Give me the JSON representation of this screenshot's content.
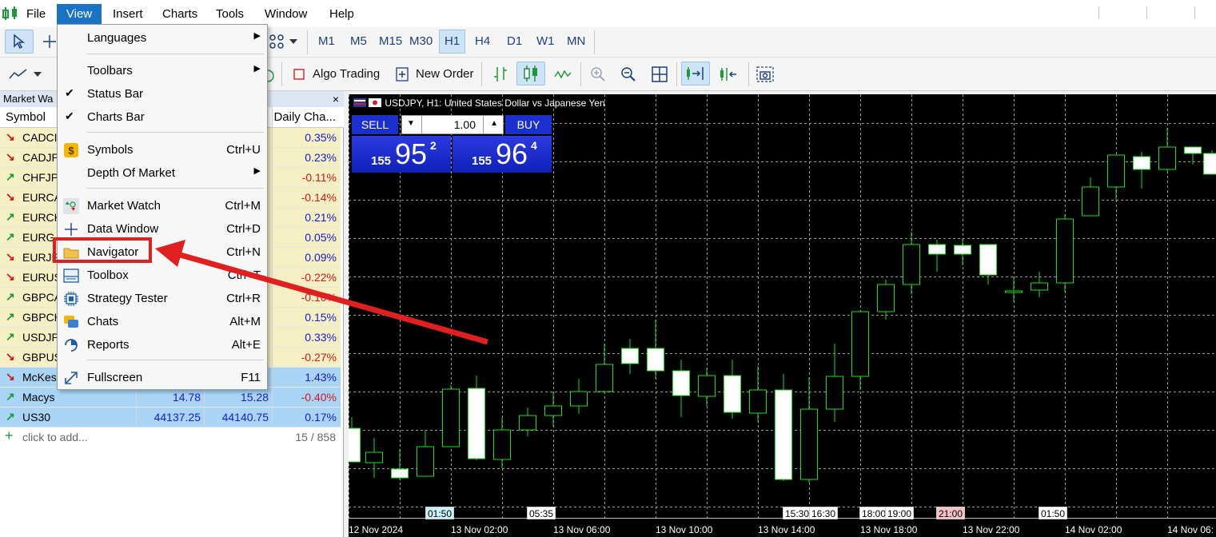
{
  "menubar": {
    "items": [
      "File",
      "View",
      "Insert",
      "Charts",
      "Tools",
      "Window",
      "Help"
    ],
    "active": "View"
  },
  "toolbar1": {
    "timeframes": [
      "M1",
      "M5",
      "M15",
      "M30",
      "H1",
      "H4",
      "D1",
      "W1",
      "MN"
    ],
    "selected_timeframe": "H1"
  },
  "toolbar2": {
    "algo_trading_label": "Algo Trading",
    "new_order_label": "New Order"
  },
  "market_watch": {
    "title": "Market Wa",
    "close_glyph": "×",
    "columns": {
      "symbol": "Symbol",
      "change": "Daily Cha..."
    },
    "rows": [
      {
        "symbol": "CADCI",
        "bid": "",
        "ask": "",
        "change": "0.35%",
        "dir": "down",
        "change_color": "#1a1ad0"
      },
      {
        "symbol": "CADJP",
        "bid": "",
        "ask": "",
        "change": "0.23%",
        "dir": "down",
        "change_color": "#1a1ad0"
      },
      {
        "symbol": "CHFJP",
        "bid": "",
        "ask": "",
        "change": "-0.11%",
        "dir": "up",
        "change_color": "#d01a1a"
      },
      {
        "symbol": "EURCA",
        "bid": "",
        "ask": "",
        "change": "-0.14%",
        "dir": "down",
        "change_color": "#d01a1a"
      },
      {
        "symbol": "EURCH",
        "bid": "",
        "ask": "",
        "change": "0.21%",
        "dir": "up",
        "change_color": "#1a1ad0"
      },
      {
        "symbol": "EURG",
        "bid": "",
        "ask": "",
        "change": "0.05%",
        "dir": "up",
        "change_color": "#1a1ad0"
      },
      {
        "symbol": "EURJP",
        "bid": "",
        "ask": "",
        "change": "0.09%",
        "dir": "down",
        "change_color": "#1a1ad0"
      },
      {
        "symbol": "EURUS",
        "bid": "",
        "ask": "",
        "change": "-0.22%",
        "dir": "down",
        "change_color": "#d01a1a"
      },
      {
        "symbol": "GBPCA",
        "bid": "",
        "ask": "",
        "change": "-0.10%",
        "dir": "up",
        "change_color": "#d01a1a"
      },
      {
        "symbol": "GBPCH",
        "bid": "",
        "ask": "",
        "change": "0.15%",
        "dir": "up",
        "change_color": "#1a1ad0"
      },
      {
        "symbol": "USDJP",
        "bid": "",
        "ask": "",
        "change": "0.33%",
        "dir": "up",
        "change_color": "#1a1ad0"
      },
      {
        "symbol": "GBPUS",
        "bid": "",
        "ask": "",
        "change": "-0.27%",
        "dir": "down",
        "change_color": "#d01a1a"
      },
      {
        "symbol": "McKes",
        "bid": "",
        "ask": "",
        "change": "1.43%",
        "dir": "down",
        "change_color": "#1a1ad0"
      },
      {
        "symbol": "Macys",
        "bid": "14.78",
        "ask": "15.28",
        "change": "-0.40%",
        "dir": "up",
        "change_color": "#d01a1a"
      },
      {
        "symbol": "US30",
        "bid": "44137.25",
        "ask": "44140.75",
        "change": "0.17%",
        "dir": "up",
        "change_color": "#1a1ad0"
      }
    ],
    "add_text": "click to add...",
    "count": "15 / 858",
    "colors": {
      "forex_row": "#f5efc4",
      "stock_row": "#a9d4f5",
      "up_arrow": "#1a9a3a",
      "down_arrow": "#d01a1a"
    }
  },
  "view_menu": {
    "items": [
      {
        "label": "Languages",
        "shortcut": "",
        "submenu": true,
        "checked": false,
        "icon": ""
      },
      {
        "label": "Toolbars",
        "shortcut": "",
        "submenu": true,
        "checked": false,
        "icon": ""
      },
      {
        "label": "Status Bar",
        "shortcut": "",
        "submenu": false,
        "checked": true,
        "icon": ""
      },
      {
        "label": "Charts Bar",
        "shortcut": "",
        "submenu": false,
        "checked": true,
        "icon": ""
      },
      {
        "label": "Symbols",
        "shortcut": "Ctrl+U",
        "submenu": false,
        "checked": false,
        "icon": "dollar-icon"
      },
      {
        "label": "Depth Of Market",
        "shortcut": "",
        "submenu": true,
        "checked": false,
        "icon": ""
      },
      {
        "label": "Market Watch",
        "shortcut": "Ctrl+M",
        "submenu": false,
        "checked": false,
        "icon": "market-watch-icon"
      },
      {
        "label": "Data Window",
        "shortcut": "Ctrl+D",
        "submenu": false,
        "checked": false,
        "icon": "crosshair-icon"
      },
      {
        "label": "Navigator",
        "shortcut": "Ctrl+N",
        "submenu": false,
        "checked": false,
        "icon": "folder-icon"
      },
      {
        "label": "Toolbox",
        "shortcut": "Ctrl+T",
        "submenu": false,
        "checked": false,
        "icon": "toolbox-icon"
      },
      {
        "label": "Strategy Tester",
        "shortcut": "Ctrl+R",
        "submenu": false,
        "checked": false,
        "icon": "chip-icon"
      },
      {
        "label": "Chats",
        "shortcut": "Alt+M",
        "submenu": false,
        "checked": false,
        "icon": "chat-icon"
      },
      {
        "label": "Reports",
        "shortcut": "Alt+E",
        "submenu": false,
        "checked": false,
        "icon": "reports-icon"
      },
      {
        "label": "Fullscreen",
        "shortcut": "F11",
        "submenu": false,
        "checked": false,
        "icon": "fullscreen-icon"
      }
    ],
    "highlighted_item": "Navigator",
    "highlight_color": "#e02020"
  },
  "chart": {
    "title": "USDJPY, H1:  United States Dollar vs Japanese Yen",
    "background": "#000000",
    "grid_color": "#9a9a9a",
    "candle_up_color": "#000000",
    "candle_down_color": "#ffffff",
    "wick_color": "#19e019",
    "trade_panel": {
      "sell_label": "SELL",
      "buy_label": "BUY",
      "lot": "1.00",
      "sell_price": {
        "prefix": "155",
        "big": "95",
        "sup": "2"
      },
      "buy_price": {
        "prefix": "155",
        "big": "96",
        "sup": "4"
      }
    },
    "time_markers": [
      {
        "text": "01:50",
        "bg": "#c9f2f6"
      },
      {
        "text": "05:35",
        "bg": "#ffffff"
      },
      {
        "text": "15:30",
        "bg": "#ffffff"
      },
      {
        "text": "16:30",
        "bg": "#ffffff"
      },
      {
        "text": "18:00",
        "bg": "#ffffff"
      },
      {
        "text": "19:00",
        "bg": "#ffffff"
      },
      {
        "text": "21:00",
        "bg": "#f6c2c8"
      },
      {
        "text": "01:50",
        "bg": "#ffffff"
      }
    ],
    "x_labels": [
      "12 Nov 2024",
      "13 Nov 02:00",
      "13 Nov 06:00",
      "13 Nov 10:00",
      "13 Nov 14:00",
      "13 Nov 18:00",
      "13 Nov 22:00",
      "14 Nov 02:00",
      "14 Nov 06:"
    ]
  }
}
